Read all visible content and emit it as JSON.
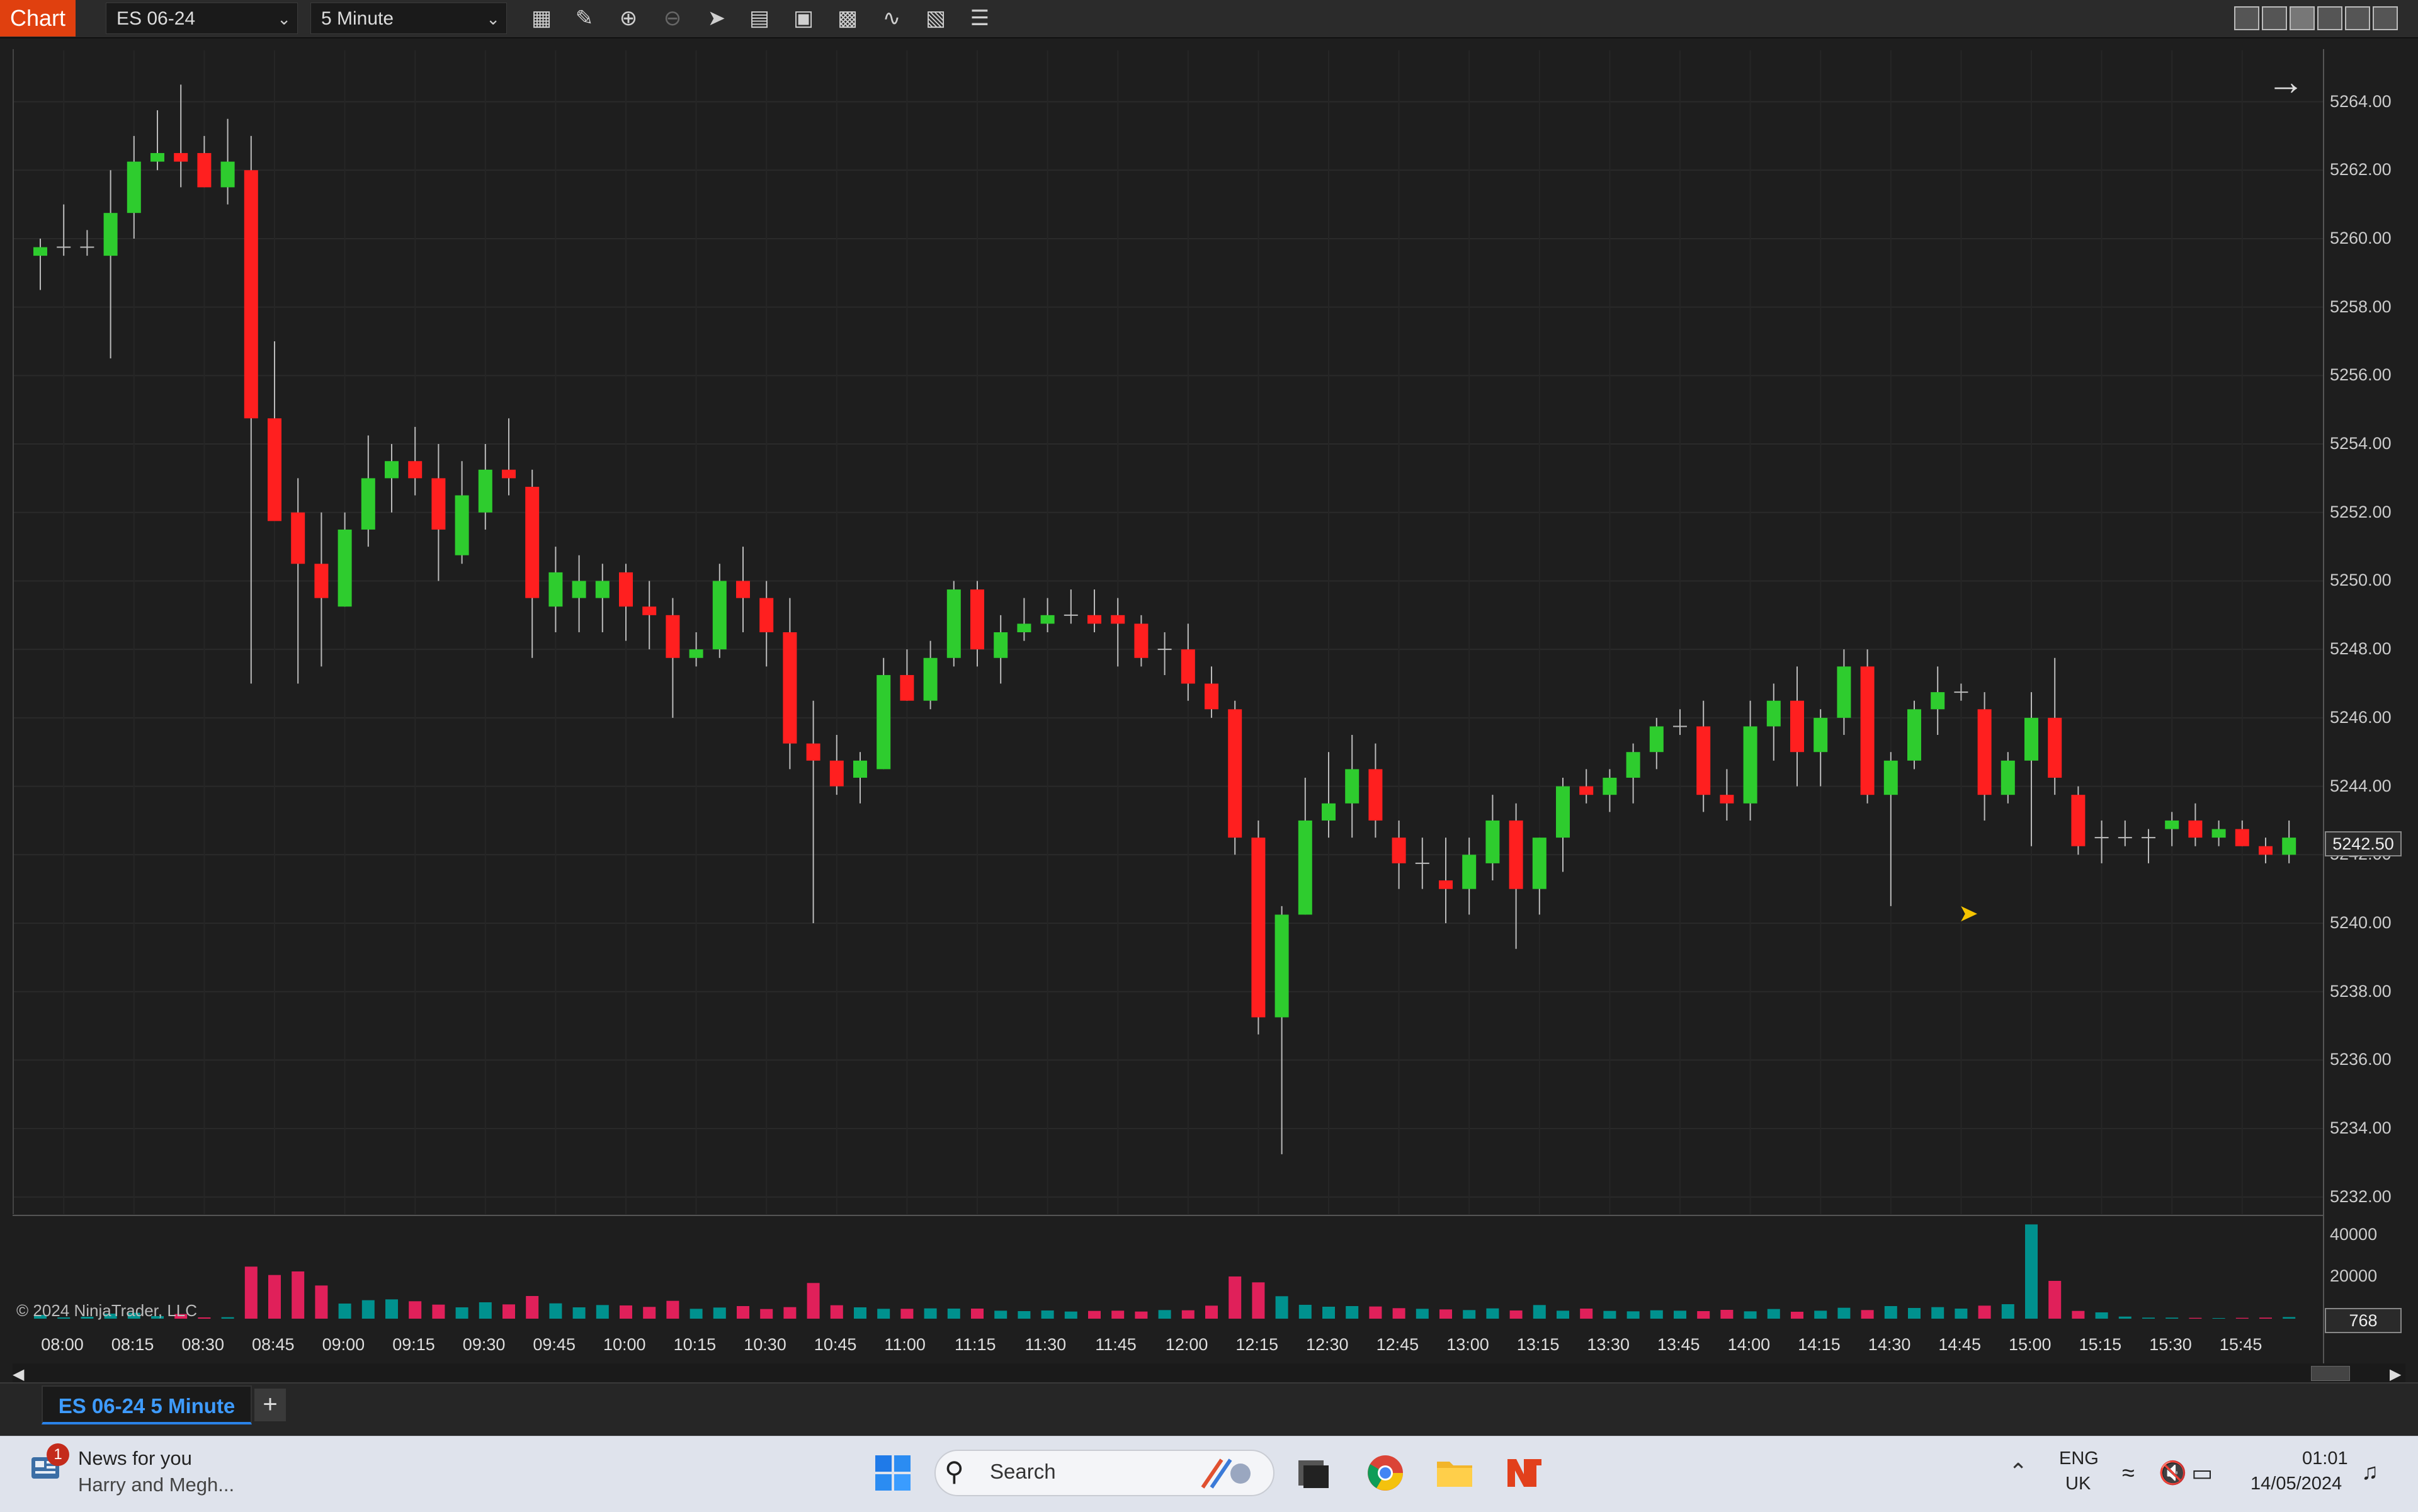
{
  "toolbar": {
    "chart_label": "Chart",
    "instrument": "ES 06-24",
    "interval": "5 Minute",
    "tools": [
      "bar-type-icon",
      "pencil-icon",
      "zoom-in-icon",
      "zoom-out-icon",
      "pointer-icon",
      "data-box-icon",
      "properties-icon",
      "chart-trader-icon",
      "strategy-icon",
      "indicator-icon",
      "list-icon"
    ]
  },
  "axis": {
    "price_labels": [
      "5264.00",
      "5262.00",
      "5260.00",
      "5258.00",
      "5256.00",
      "5254.00",
      "5252.00",
      "5250.00",
      "5248.00",
      "5246.00",
      "5244.00",
      "5242.00",
      "5240.00",
      "5238.00",
      "5236.00",
      "5234.00",
      "5232.00"
    ],
    "volume_labels": [
      "40000",
      "20000"
    ],
    "time_labels": [
      "08:00",
      "08:15",
      "08:30",
      "08:45",
      "09:00",
      "09:15",
      "09:30",
      "09:45",
      "10:00",
      "10:15",
      "10:30",
      "10:45",
      "11:00",
      "11:15",
      "11:30",
      "11:45",
      "12:00",
      "12:15",
      "12:30",
      "12:45",
      "13:00",
      "13:15",
      "13:30",
      "13:45",
      "14:00",
      "14:15",
      "14:30",
      "14:45",
      "15:00",
      "15:15",
      "15:30",
      "15:45"
    ],
    "last_price": "5242.50",
    "last_volume": "768"
  },
  "copyright": "© 2024 NinjaTrader, LLC",
  "tabs": {
    "main": "ES 06-24 5 Minute",
    "add": "+"
  },
  "colors": {
    "up": "#2ecc2e",
    "down": "#ff1f1f",
    "vol_up": "#00918e",
    "vol_down": "#e0205a"
  },
  "chart_data": {
    "type": "candlestick",
    "ylim": [
      5231.5,
      5265.5
    ],
    "volume_ylim": [
      0,
      48000
    ],
    "start_time": "07:55",
    "bar_minutes": 5,
    "candles": [
      [
        5259.5,
        5260,
        5258.5,
        5259.75
      ],
      [
        5259.75,
        5261,
        5259.5,
        5259.75
      ],
      [
        5259.75,
        5260.25,
        5259.5,
        5259.75
      ],
      [
        5259.5,
        5262,
        5256.5,
        5260.75
      ],
      [
        5260.75,
        5263,
        5260,
        5262.25
      ],
      [
        5262.25,
        5263.75,
        5262,
        5262.5
      ],
      [
        5262.5,
        5264.5,
        5261.5,
        5262.25
      ],
      [
        5262.5,
        5263,
        5261.5,
        5261.5
      ],
      [
        5261.5,
        5263.5,
        5261,
        5262.25
      ],
      [
        5262,
        5263,
        5247,
        5254.75
      ],
      [
        5254.75,
        5257,
        5252,
        5251.75
      ],
      [
        5252,
        5253,
        5247,
        5250.5
      ],
      [
        5250.5,
        5252,
        5247.5,
        5249.5
      ],
      [
        5249.25,
        5252,
        5249.25,
        5251.5
      ],
      [
        5251.5,
        5254.25,
        5251,
        5253
      ],
      [
        5253,
        5254,
        5252,
        5253.5
      ],
      [
        5253.5,
        5254.5,
        5252.5,
        5253
      ],
      [
        5253,
        5254,
        5250,
        5251.5
      ],
      [
        5250.75,
        5253.5,
        5250.5,
        5252.5
      ],
      [
        5252,
        5254,
        5251.5,
        5253.25
      ],
      [
        5253.25,
        5254.75,
        5252.5,
        5253
      ],
      [
        5252.75,
        5253.25,
        5247.75,
        5249.5
      ],
      [
        5249.25,
        5251,
        5248.5,
        5250.25
      ],
      [
        5249.5,
        5250.75,
        5248.5,
        5250
      ],
      [
        5249.5,
        5250.5,
        5248.5,
        5250
      ],
      [
        5250.25,
        5250.5,
        5248.25,
        5249.25
      ],
      [
        5249.25,
        5250,
        5248,
        5249
      ],
      [
        5249,
        5249.5,
        5246,
        5247.75
      ],
      [
        5247.75,
        5248.5,
        5247.5,
        5248
      ],
      [
        5248,
        5250.5,
        5247.75,
        5250
      ],
      [
        5250,
        5251,
        5248.5,
        5249.5
      ],
      [
        5249.5,
        5250,
        5247.5,
        5248.5
      ],
      [
        5248.5,
        5249.5,
        5244.5,
        5245.25
      ],
      [
        5245.25,
        5246.5,
        5240,
        5244.75
      ],
      [
        5244.75,
        5245.5,
        5243.75,
        5244
      ],
      [
        5244.25,
        5245,
        5243.5,
        5244.75
      ],
      [
        5244.5,
        5247.75,
        5244.5,
        5247.25
      ],
      [
        5247.25,
        5248,
        5246.5,
        5246.5
      ],
      [
        5246.5,
        5248.25,
        5246.25,
        5247.75
      ],
      [
        5247.75,
        5250,
        5247.5,
        5249.75
      ],
      [
        5249.75,
        5250,
        5247.5,
        5248
      ],
      [
        5247.75,
        5249,
        5247,
        5248.5
      ],
      [
        5248.5,
        5249.5,
        5248.25,
        5248.75
      ],
      [
        5248.75,
        5249.5,
        5248.5,
        5249
      ],
      [
        5249,
        5249.75,
        5248.75,
        5249
      ],
      [
        5249,
        5249.75,
        5248.5,
        5248.75
      ],
      [
        5249,
        5249.5,
        5247.5,
        5248.75
      ],
      [
        5248.75,
        5249,
        5247.5,
        5247.75
      ],
      [
        5248,
        5248.5,
        5247.25,
        5248
      ],
      [
        5248,
        5248.75,
        5246.5,
        5247
      ],
      [
        5247,
        5247.5,
        5246,
        5246.25
      ],
      [
        5246.25,
        5246.5,
        5242,
        5242.5
      ],
      [
        5242.5,
        5243,
        5236.75,
        5237.25
      ],
      [
        5237.25,
        5240.5,
        5233.25,
        5240.25
      ],
      [
        5240.25,
        5244.25,
        5240.25,
        5243
      ],
      [
        5243,
        5245,
        5242.5,
        5243.5
      ],
      [
        5243.5,
        5245.5,
        5242.5,
        5244.5
      ],
      [
        5244.5,
        5245.25,
        5242.5,
        5243
      ],
      [
        5242.5,
        5243,
        5241,
        5241.75
      ],
      [
        5241.75,
        5242.5,
        5241,
        5241.75
      ],
      [
        5241.25,
        5242.5,
        5240,
        5241
      ],
      [
        5241,
        5242.5,
        5240.25,
        5242
      ],
      [
        5241.75,
        5243.75,
        5241.25,
        5243
      ],
      [
        5243,
        5243.5,
        5239.25,
        5241
      ],
      [
        5241,
        5242.5,
        5240.25,
        5242.5
      ],
      [
        5242.5,
        5244.25,
        5241.5,
        5244
      ],
      [
        5244,
        5244.5,
        5243.5,
        5243.75
      ],
      [
        5243.75,
        5244.5,
        5243.25,
        5244.25
      ],
      [
        5244.25,
        5245.25,
        5243.5,
        5245
      ],
      [
        5245,
        5246,
        5244.5,
        5245.75
      ],
      [
        5245.75,
        5246.25,
        5245.5,
        5245.75
      ],
      [
        5245.75,
        5246.5,
        5243.25,
        5243.75
      ],
      [
        5243.75,
        5244.5,
        5243,
        5243.5
      ],
      [
        5243.5,
        5246.5,
        5243,
        5245.75
      ],
      [
        5245.75,
        5247,
        5244.75,
        5246.5
      ],
      [
        5246.5,
        5247.5,
        5244,
        5245
      ],
      [
        5245,
        5246.25,
        5244,
        5246
      ],
      [
        5246,
        5248,
        5245.5,
        5247.5
      ],
      [
        5247.5,
        5248,
        5243.5,
        5243.75
      ],
      [
        5243.75,
        5245,
        5240.5,
        5244.75
      ],
      [
        5244.75,
        5246.5,
        5244.5,
        5246.25
      ],
      [
        5246.25,
        5247.5,
        5245.5,
        5246.75
      ],
      [
        5246.75,
        5247,
        5246.5,
        5246.75
      ],
      [
        5246.25,
        5246.75,
        5243,
        5243.75
      ],
      [
        5243.75,
        5245,
        5243.5,
        5244.75
      ],
      [
        5244.75,
        5246.75,
        5242.25,
        5246
      ],
      [
        5246,
        5247.75,
        5243.75,
        5244.25
      ],
      [
        5243.75,
        5244,
        5242,
        5242.25
      ],
      [
        5242.5,
        5243,
        5241.75,
        5242.5
      ],
      [
        5242.5,
        5243,
        5242.25,
        5242.5
      ],
      [
        5242.5,
        5242.75,
        5241.75,
        5242.5
      ],
      [
        5242.75,
        5243.25,
        5242.25,
        5243
      ],
      [
        5243,
        5243.5,
        5242.25,
        5242.5
      ],
      [
        5242.5,
        5243,
        5242.25,
        5242.75
      ],
      [
        5242.75,
        5243,
        5242.25,
        5242.25
      ],
      [
        5242.25,
        5242.5,
        5241.75,
        5242
      ],
      [
        5242,
        5243,
        5241.75,
        5242.5
      ]
    ],
    "volume": [
      1800,
      600,
      900,
      2400,
      2800,
      1200,
      2200,
      600,
      700,
      24800,
      20800,
      22500,
      15800,
      7200,
      8800,
      9200,
      8300,
      6700,
      5400,
      7800,
      6800,
      10800,
      7300,
      5400,
      6500,
      6300,
      5600,
      8500,
      4700,
      5300,
      6000,
      4600,
      5500,
      17000,
      6400,
      5400,
      4700,
      4700,
      4900,
      4800,
      4800,
      3800,
      3600,
      3900,
      3400,
      3700,
      3800,
      3400,
      4100,
      4000,
      6200,
      20100,
      17300,
      10700,
      6600,
      5700,
      6000,
      5800,
      5000,
      4700,
      4400,
      4100,
      4900,
      3900,
      6500,
      3800,
      4800,
      3700,
      3500,
      4000,
      3800,
      3600,
      4200,
      3500,
      4600,
      3300,
      3800,
      5200,
      4100,
      6000,
      5100,
      5500,
      4800,
      6200,
      6900,
      44900,
      18000,
      3700,
      3000,
      1000,
      500,
      500,
      400,
      300,
      400,
      500,
      768
    ]
  }
}
